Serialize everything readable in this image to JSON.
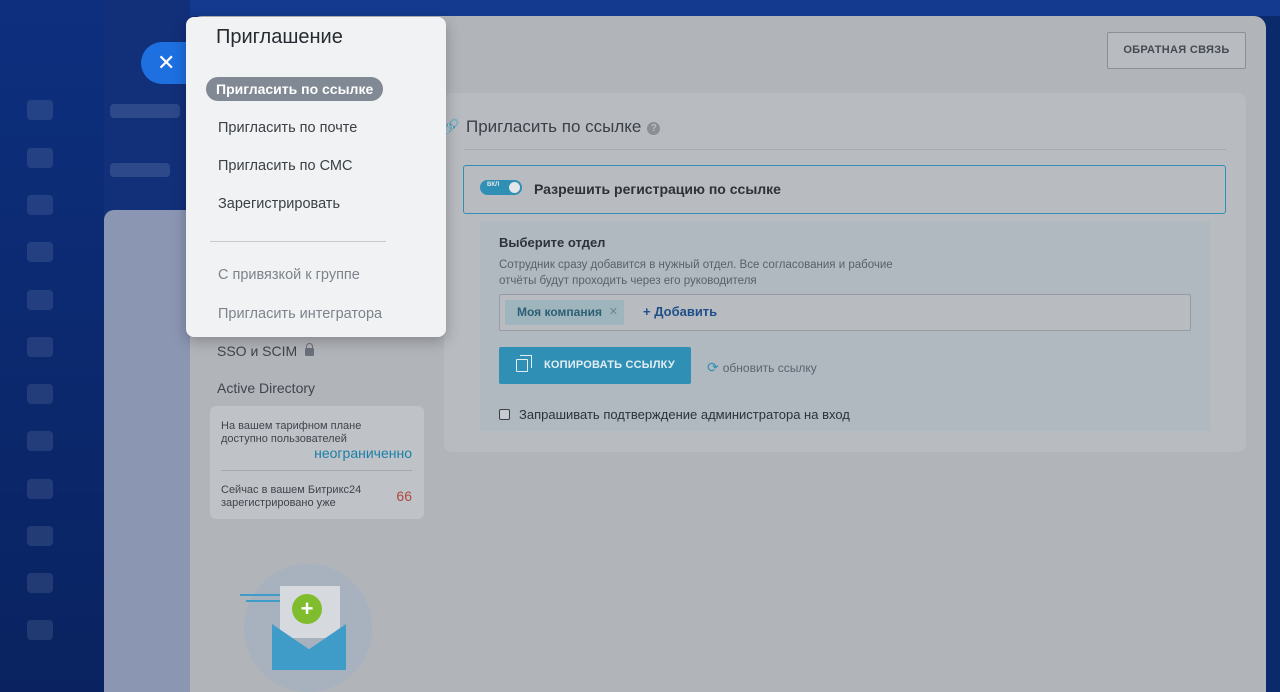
{
  "popup": {
    "title": "Приглашение",
    "items": [
      {
        "label": "Пригласить по ссылке",
        "active": true
      },
      {
        "label": "Пригласить по почте"
      },
      {
        "label": "Пригласить по СМС"
      },
      {
        "label": "Зарегистрировать"
      },
      {
        "label": "С привязкой к группе"
      },
      {
        "label": "Пригласить интегратора"
      }
    ]
  },
  "header": {
    "close_icon": "close-icon",
    "feedback_label": "ОБРАТНАЯ СВЯЗЬ"
  },
  "left_menu": {
    "sso_label": "SSO и SCIM",
    "ad_label": "Active Directory"
  },
  "plan": {
    "available_label": "На вашем тарифном плане доступно пользователей",
    "available_value": "неограниченно",
    "registered_label": "Сейчас в вашем Битрикс24 зарегистрировано уже",
    "registered_value": "66"
  },
  "main": {
    "title": "Пригласить по ссылке",
    "toggle": {
      "state_text": "ВКЛ",
      "label": "Разрешить регистрацию по ссылке",
      "on": true
    },
    "department": {
      "title": "Выберите отдел",
      "desc": "Сотрудник сразу добавится в нужный отдел. Все согласования и рабочие отчёты будут проходить через его руководителя",
      "tag": "Моя компания",
      "add_label": "+ Добавить"
    },
    "copy_label": "КОПИРОВАТЬ ССЫЛКУ",
    "refresh_label": "обновить ссылку",
    "confirm_label": "Запрашивать подтверждение администратора на вход"
  },
  "colors": {
    "accent": "#2f8fb5",
    "overlay_panel": "#b1b4b9",
    "popup_bg": "#f0f2f4"
  }
}
